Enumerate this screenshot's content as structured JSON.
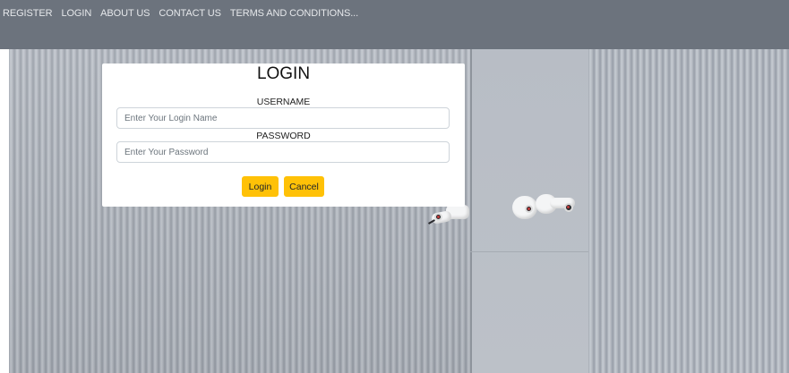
{
  "navbar": {
    "links": [
      {
        "label": "REGISTER"
      },
      {
        "label": "LOGIN"
      },
      {
        "label": "ABOUT US"
      },
      {
        "label": "CONTACT US"
      },
      {
        "label": "TERMS AND CONDITIONS..."
      }
    ],
    "background_color": "#6c737d"
  },
  "login_form": {
    "title": "LOGIN",
    "username_label": "USERNAME",
    "username_placeholder": "Enter Your Login Name",
    "username_value": "",
    "password_label": "PASSWORD",
    "password_placeholder": "Enter Your Password",
    "password_value": "",
    "login_button": "Login",
    "cancel_button": "Cancel",
    "button_color": "#ffc107"
  },
  "background": {
    "description_icon": "security-camera-icon"
  }
}
